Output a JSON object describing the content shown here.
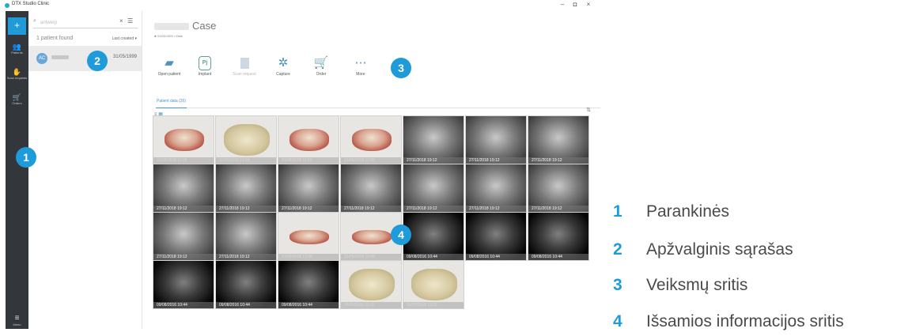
{
  "app": {
    "title": "DTX Studio Clinic",
    "window_controls": [
      "–",
      "◘",
      "×"
    ]
  },
  "rail": {
    "add_label": "+",
    "items": [
      {
        "label": "Patients",
        "icon": "patients-icon"
      },
      {
        "label": "Scan requests",
        "icon": "scan-requests-icon"
      },
      {
        "label": "Orders",
        "icon": "cart-icon"
      }
    ],
    "menu_label": "Menu"
  },
  "list": {
    "search_value": "antwerp",
    "count_text": "1 patient found",
    "sort_label": "Last created ▾",
    "patient": {
      "initials": "AC",
      "date": "31/05/1999"
    }
  },
  "header": {
    "title": "Case",
    "subtitle": "♣ 31/05/1999 • Male"
  },
  "actions": [
    {
      "label": "Open patient",
      "icon": "folder-icon",
      "enabled": true
    },
    {
      "label": "Implant",
      "icon": "implant-icon",
      "glyph": "Pj",
      "enabled": true
    },
    {
      "label": "Scan request",
      "icon": "document-icon",
      "enabled": false
    },
    {
      "label": "Capture",
      "icon": "capture-icon",
      "enabled": true
    },
    {
      "label": "Order",
      "icon": "cart-icon",
      "enabled": true
    },
    {
      "label": "More",
      "icon": "more-icon",
      "enabled": true
    }
  ],
  "tabs": [
    {
      "label": "Patient data (26)"
    }
  ],
  "thumbnails": [
    {
      "kind": "model-red",
      "time": "31/05/2018 11:59"
    },
    {
      "kind": "model-stone",
      "time": "31/05/2018 11:59"
    },
    {
      "kind": "model-red",
      "time": "31/05/2018 11:55"
    },
    {
      "kind": "model-red",
      "time": "31/05/2018 12:06"
    },
    {
      "kind": "xray",
      "time": "27/11/2018 19:12"
    },
    {
      "kind": "xray",
      "time": "27/11/2018 19:12"
    },
    {
      "kind": "xray",
      "time": "27/11/2018 19:12"
    },
    {
      "kind": "xray",
      "time": "27/11/2018 19:12"
    },
    {
      "kind": "xray",
      "time": "27/11/2018 19:12"
    },
    {
      "kind": "xray",
      "time": "27/11/2018 19:12"
    },
    {
      "kind": "xray",
      "time": "27/11/2018 19:12"
    },
    {
      "kind": "xray",
      "time": "27/11/2018 19:12"
    },
    {
      "kind": "xray",
      "time": "27/11/2018 19:12"
    },
    {
      "kind": "xray",
      "time": "27/11/2018 19:12"
    },
    {
      "kind": "xray",
      "time": "27/11/2018 19:12"
    },
    {
      "kind": "xray",
      "time": "27/11/2018 19:12"
    },
    {
      "kind": "model-flat",
      "time": "31/05/2018 12:06"
    },
    {
      "kind": "model-flat",
      "time": "31/05/2018 12:06"
    },
    {
      "kind": "cbct",
      "time": "09/08/2016 10:44"
    },
    {
      "kind": "cbct",
      "time": "09/08/2016 10:44"
    },
    {
      "kind": "cbct",
      "time": "09/08/2016 10:44"
    },
    {
      "kind": "cbct",
      "time": "09/08/2016 10:44"
    },
    {
      "kind": "cbct",
      "time": "09/08/2016 10:44"
    },
    {
      "kind": "cbct",
      "time": "09/08/2016 10:44"
    },
    {
      "kind": "model-stone",
      "time": "06/05/2016 11:25"
    },
    {
      "kind": "model-stone",
      "time": "06/05/2016 11:25"
    }
  ],
  "markers": [
    "1",
    "2",
    "3",
    "4"
  ],
  "legend": [
    {
      "num": "1",
      "text": "Parankinės"
    },
    {
      "num": "2",
      "text": "Apžvalginis sąrašas"
    },
    {
      "num": "3",
      "text": "Veiksmų sritis"
    },
    {
      "num": "4",
      "text": "Išsamios informacijos sritis"
    }
  ],
  "colors": {
    "accent": "#1e9bd8",
    "rail": "#33363b",
    "action_icon": "#4d93c4"
  }
}
